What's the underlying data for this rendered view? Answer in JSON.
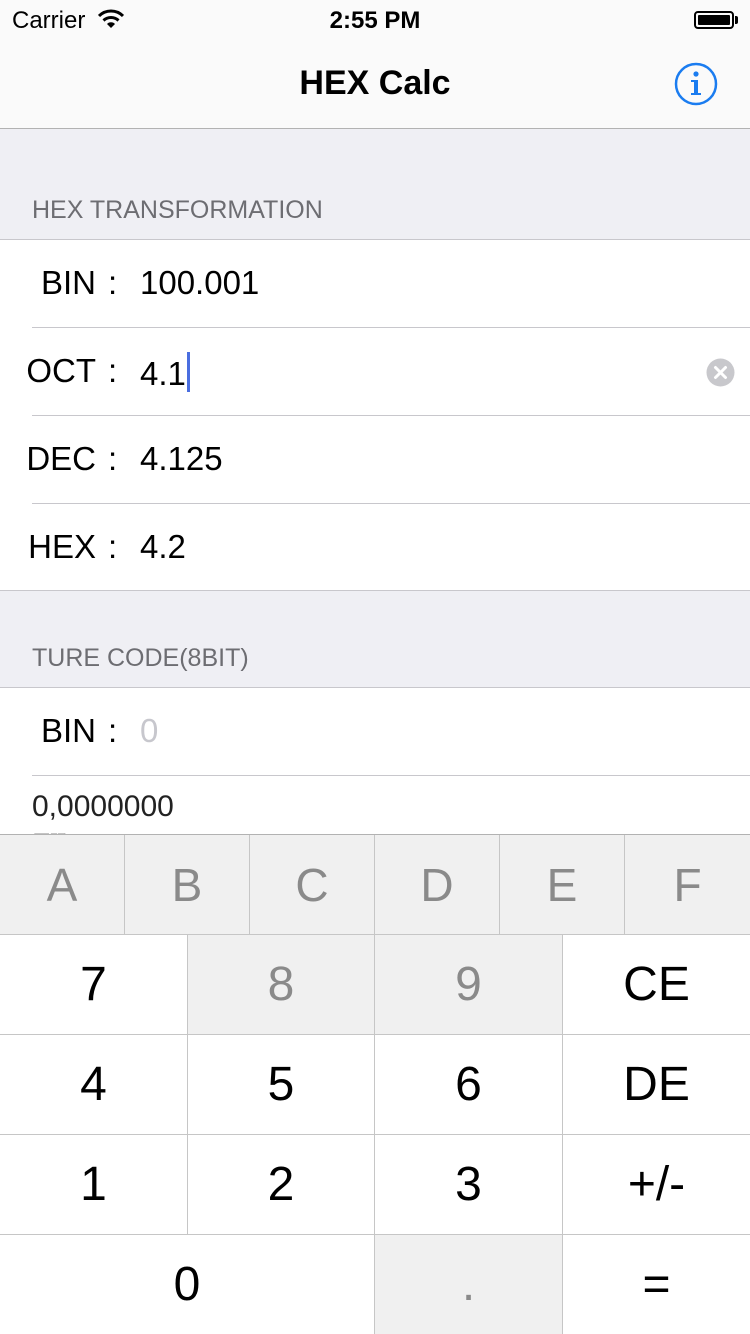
{
  "status_bar": {
    "carrier": "Carrier",
    "time": "2:55 PM"
  },
  "nav": {
    "title": "HEX Calc",
    "info_icon": "info-circle-icon"
  },
  "hex_section": {
    "header": "HEX TRANSFORMATION",
    "rows": [
      {
        "label": "BIN",
        "colon": ":",
        "value": "100.001"
      },
      {
        "label": "OCT",
        "colon": ":",
        "value": "4.1"
      },
      {
        "label": "DEC",
        "colon": ":",
        "value": "4.125"
      },
      {
        "label": "HEX",
        "colon": ":",
        "value": "4.2"
      }
    ]
  },
  "true_code_section": {
    "header": "TURE CODE(8BIT)",
    "bin_label": "BIN",
    "colon": ":",
    "bin_placeholder": "0",
    "code_value": "0,0000000",
    "code_caption": "原码(TURECODE)"
  },
  "keyboard": {
    "hex_keys": [
      "A",
      "B",
      "C",
      "D",
      "E",
      "F"
    ],
    "rows": [
      [
        "7",
        "8",
        "9",
        "CE"
      ],
      [
        "4",
        "5",
        "6",
        "DE"
      ],
      [
        "1",
        "2",
        "3",
        "+/-"
      ],
      [
        "0",
        ".",
        "="
      ]
    ]
  },
  "colors": {
    "accent": "#1a7cf0",
    "cursor": "#4a6ee0",
    "disabled_key": "#f0f0f0",
    "background": "#efeff4"
  }
}
